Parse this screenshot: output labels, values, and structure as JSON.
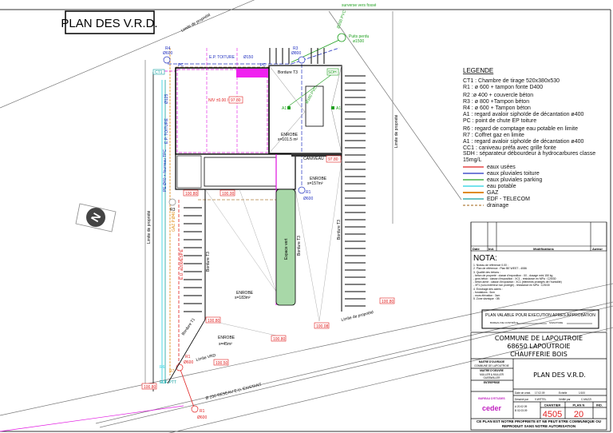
{
  "title": "PLAN DES V.R.D.",
  "colors": {
    "eaux_usees": "#e02020",
    "eaux_pluviales_toiture": "#2030c0",
    "eaux_pluviales_parking": "#20a020",
    "eau_potable": "#20d0e0",
    "gaz": "#e08a10",
    "edf_telecom": "#10a0a0",
    "drainage": "#b08040",
    "magenta": "#e010e0",
    "level_red": "#e02020"
  },
  "plan": {
    "limite_propriete": "Limite de propriété",
    "limite_vrd": "Limite VRD",
    "reseau": "Ø 250 RESEAU E.U. EXISTANT",
    "ep_toiture": "E.P. TOITURE",
    "diam150": "Ø150",
    "diam125": "Ø125",
    "diam160pvc": "Ø160 PVC",
    "diam200pvc": "Ø200 PVC",
    "puits": "Puits perdu",
    "puits_d": "ø1500",
    "surverse": "surverse vers fossé",
    "niv": "NIV ±0.00 /",
    "niv_val": "97.80",
    "bordure_t3": "Bordure T3",
    "bordure_t1": "Bordure T1",
    "espace_vert": "Espace vert",
    "caniveau": "CANIVEAU",
    "gaz_label": "GAZ P.Ø40",
    "eu_label": "E.U. ø200/ESP.E",
    "pe_label": "PE Ø40 + fourreau TPC",
    "edf": "EDF-PTT",
    "enrobe1": "ENROBE",
    "enrobe1_s": "s=101.5 m²",
    "enrobe2": "ENROBE",
    "enrobe2_s": "s=157m²",
    "enrobe3": "ENROBE",
    "enrobe3_s": "s=183m²",
    "enrobe4": "ENROBE",
    "enrobe4_s": "s=45m²",
    "levels": [
      "97.80",
      "100.00",
      "100.80",
      "100.80",
      "100.80",
      "100.08",
      "100.50",
      "100.80",
      "100.80"
    ],
    "r4": "R4",
    "r4d": "Ø600",
    "r3": "R3",
    "r3d": "Ø800",
    "r1": "R1",
    "r1d": "Ø600",
    "r2": "R2",
    "r6": "R6",
    "r7": "R7",
    "pc": "PC",
    "a1": "A1",
    "sdh": "SDH",
    "ct1": "CT1"
  },
  "legend": {
    "title": "LEGENDE",
    "items": [
      "CT1 : Chambre de tirage 520x380x530",
      "R1 : ø 600 + tampon fonte D400",
      "R2 :ø 400 + couvercle béton",
      "R3 : ø 800 +Tampon béton",
      "R4 : ø 600 + Tampon béton",
      "A1 : regard avaloir siphoïde de décantation ø400",
      "PC : point de chute EP toiture",
      "R6 : regard de comptage eau potable en limite",
      "R7 : Coffret gaz en limite",
      "A1 : regard avaloir siphoïde de décantation ø400",
      "CC1 : caniveau  préfa  avec grille fonte",
      "SDH : séparateur débourdeur à hydrocarbures classe 15mg/L"
    ],
    "lines": [
      {
        "label": "eaux usées",
        "color": "#e02020"
      },
      {
        "label": "eaux pluviales toiture",
        "color": "#2030c0"
      },
      {
        "label": "eaux pluviales parking",
        "color": "#20a020"
      },
      {
        "label": "eau potable",
        "color": "#20d0e0"
      },
      {
        "label": "GAZ",
        "color": "#e08a10"
      },
      {
        "label": "EDF - TELECOM",
        "color": "#10a0a0"
      },
      {
        "label": "drainage",
        "color": "#b08040"
      }
    ]
  },
  "revisions": {
    "date": "Date",
    "ind": "Ind.",
    "modifs": "Modifications",
    "auteur": "Auteur"
  },
  "nota": {
    "title": "NOTA:",
    "lines": [
      "1. Niveau de référence 0.00 :",
      "2. Plan de référence : Plan BE WEST - 4086",
      "3. Qualité des bétons :",
      "  - béton de propreté : classe d'exposition : X0 - dosage mini 150 kg",
      "  - gros béton : classe d'exposition : XC1 - résistance en MPa : C25/30",
      "  - béton armé : classe d'exposition : XC1 (éléments protégés de l'humidité)",
      "  - XF1 (volu extérieur non protégé) - résistance en MPa : C25/30",
      "4. Enrobage des aciers :",
      "  - fondations : 5cm",
      "  - murs élévation : 3cm",
      "5. Zone sismique : 0B"
    ],
    "approval": "PLAN VALABLE POUR EXECUTION APRES APPROBATION",
    "approval_bet": "BUREAU DE CONTRÔLE",
    "approval_date": "SIGNATURE"
  },
  "title_block": {
    "line1": "COMMUNE DE LAPOUTROIE",
    "line2": "68650 LAPOUTROIE",
    "line3": "CHAUFFERIE BOIS",
    "moa_label": "MAITRE D'OUVRAGE",
    "moa": "COMMUNE DE LAPOUTROIE",
    "moe_label": "MAITRE D'OEUVRE",
    "moe1": "MULLER & MULLER",
    "moe2": "GUEBWILLER",
    "entreprise_label": "ENTREPRISE",
    "plan_title": "PLAN DES V.R.D.",
    "date_label": "Date de créat.",
    "date_val": "17.02.09",
    "echelle_label": "Echelle",
    "echelle_val": "1/100",
    "dessine_label": "Dessiné par",
    "dessine_val": "V.WITTEL",
    "verifie_label": "Vérifié par",
    "verifie_val": "C.MUZZI",
    "chantier_label": "CHANTIER",
    "chantier_val": "4505",
    "plan_label": "PLAN N",
    "plan_val": "20",
    "ind_label": "IND.",
    "ceder": "ceder",
    "ceder_top": "BUREAU D'ETUDES",
    "footer": "CE PLAN EST NOTRE PROPRIETE ET NE PEUT ETRE COMMUNIQUE OU REPRODUIT SANS NOTRE AUTORISATION",
    "revs": [
      "A  20.02.09",
      "B  02.03.09"
    ]
  }
}
